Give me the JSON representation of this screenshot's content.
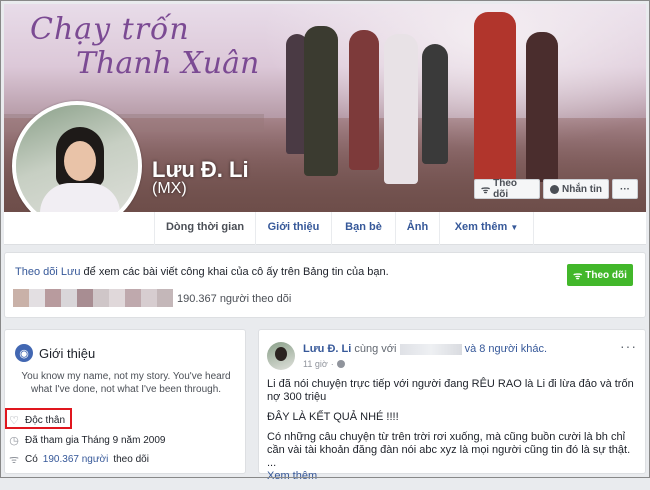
{
  "cover": {
    "title_line1": "Chạy trốn",
    "title_line2": "Thanh Xuân"
  },
  "profile": {
    "name": "Lưu Đ. Li",
    "nickname": "(MX)"
  },
  "cover_buttons": {
    "follow": "Theo dõi",
    "message": "Nhắn tin",
    "more": "···"
  },
  "tabs": [
    "Dòng thời gian",
    "Giới thiệu",
    "Bạn bè",
    "Ảnh",
    "Xem thêm"
  ],
  "follow_box": {
    "link_text": "Theo dõi Lưu",
    "text": " để xem các bài viết công khai của cô ấy trên Bảng tin của bạn.",
    "button": "Theo dõi",
    "followers": "190.367 người theo dõi"
  },
  "intro": {
    "title": "Giới thiệu",
    "bio": "You know my name, not my story. You've heard what I've done, not what I've been through.",
    "relationship": "Độc thân",
    "joined": "Đã tham gia Tháng 9 năm 2009",
    "followers_prefix": "Có",
    "followers_count": "190.367 người",
    "followers_suffix": "theo dõi"
  },
  "post": {
    "author": "Lưu Đ. Li",
    "with_text": "cùng với",
    "others": "và 8 người khác.",
    "time": "11 giờ",
    "more": "···",
    "p1": "Li đã nói chuyện trực tiếp với người đang RÊU RAO là Li đi lừa đảo và trốn nợ 300 triệu",
    "p2": "ĐÂY LÀ KẾT QUẢ NHÉ !!!!",
    "p3": "Có những câu chuyện từ trên trời rơi xuống, mà cũng buồn cười là bh chỉ cần vài tài khoản đăng đàn nói abc xyz là mọi người cũng tin đó là sự thật. ...",
    "see_more": "Xem thêm"
  }
}
